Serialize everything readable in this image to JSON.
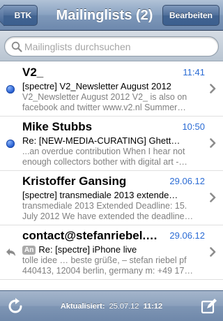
{
  "nav": {
    "back_label": "BTK",
    "title": "Mailinglists (2)",
    "edit_label": "Bearbeiten"
  },
  "search": {
    "placeholder": "Mailinglists durchsuchen"
  },
  "messages": [
    {
      "sender": "V2_",
      "date": "11:41",
      "subject": "[spectre] V2_Newsletter August 2012",
      "preview": "V2_Newsletter August 2012 V2_ is also on facebook and twitter www.v2.nl Summer…",
      "unread": true,
      "replied": false,
      "tag": ""
    },
    {
      "sender": "Mike Stubbs",
      "date": "10:50",
      "subject": "Re: [NEW-MEDIA-CURATING] Ghett…",
      "preview": "...an overdue contribution When I hear not enough collectors bother with digital art -…",
      "unread": true,
      "replied": false,
      "tag": ""
    },
    {
      "sender": "Kristoffer Gansing",
      "date": "29.06.12",
      "subject": "[spectre] transmediale 2013 extende…",
      "preview": "transmediale 2013 Extended Deadline: 15. July 2012 We have extended the deadline…",
      "unread": false,
      "replied": false,
      "tag": ""
    },
    {
      "sender": "contact@stefanriebel.…",
      "date": "29.06.12",
      "subject": "Re: [spectre] iPhone live",
      "preview": "tolle idee … beste grüße, – stefan riebel pf 440413, 12004 berlin, germany m: +49 17…",
      "unread": false,
      "replied": true,
      "tag": "An"
    }
  ],
  "toolbar": {
    "status_label": "Aktualisiert:",
    "status_date": "25.07.12",
    "status_time": "11:12"
  },
  "colors": {
    "accent_blue": "#2a6bd4",
    "navbar": "#6d88ad"
  }
}
